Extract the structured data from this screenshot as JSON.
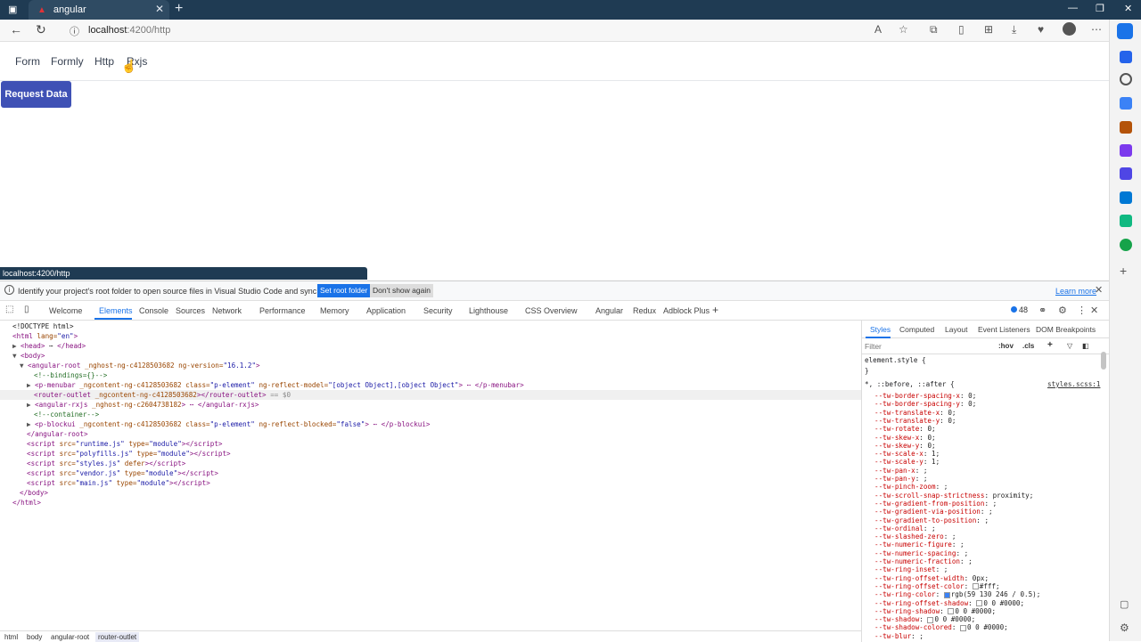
{
  "browser": {
    "tab_title": "angular",
    "url_host": "localhost",
    "url_path": ":4200/http"
  },
  "page": {
    "menu": [
      "Form",
      "Formly",
      "Http",
      "Rxjs"
    ],
    "request_button": "Request Data",
    "status_url": "localhost:4200/http"
  },
  "devtools": {
    "infobar": {
      "message": "Identify your project's root folder to open source files in Visual Studio Code and sync changes.",
      "set_root": "Set root folder",
      "dont_show": "Don't show again",
      "learn_more": "Learn more"
    },
    "tabs": [
      "Welcome",
      "Elements",
      "Console",
      "Sources",
      "Network",
      "Performance",
      "Memory",
      "Application",
      "Security",
      "Lighthouse",
      "CSS Overview",
      "Angular",
      "Redux",
      "Adblock Plus"
    ],
    "active_tab": "Elements",
    "issues_count": "48",
    "breadcrumbs": [
      "html",
      "body",
      "angular-root",
      "router-outlet"
    ],
    "styles": {
      "tabs": [
        "Styles",
        "Computed",
        "Layout",
        "Event Listeners",
        "DOM Breakpoints"
      ],
      "filter_placeholder": "Filter",
      "hov": ":hov",
      "cls": ".cls",
      "element_style": "element.style {",
      "element_close": "}",
      "selector": "*, ::before, ::after {",
      "source": "styles.scss:1",
      "props": [
        {
          "name": "--tw-border-spacing-x",
          "value": "0;"
        },
        {
          "name": "--tw-border-spacing-y",
          "value": "0;"
        },
        {
          "name": "--tw-translate-x",
          "value": "0;"
        },
        {
          "name": "--tw-translate-y",
          "value": "0;"
        },
        {
          "name": "--tw-rotate",
          "value": "0;"
        },
        {
          "name": "--tw-skew-x",
          "value": "0;"
        },
        {
          "name": "--tw-skew-y",
          "value": "0;"
        },
        {
          "name": "--tw-scale-x",
          "value": "1;"
        },
        {
          "name": "--tw-scale-y",
          "value": "1;"
        },
        {
          "name": "--tw-pan-x",
          "value": ";"
        },
        {
          "name": "--tw-pan-y",
          "value": ";"
        },
        {
          "name": "--tw-pinch-zoom",
          "value": ";"
        },
        {
          "name": "--tw-scroll-snap-strictness",
          "value": "proximity;"
        },
        {
          "name": "--tw-gradient-from-position",
          "value": ";"
        },
        {
          "name": "--tw-gradient-via-position",
          "value": ";"
        },
        {
          "name": "--tw-gradient-to-position",
          "value": ";"
        },
        {
          "name": "--tw-ordinal",
          "value": ";"
        },
        {
          "name": "--tw-slashed-zero",
          "value": ";"
        },
        {
          "name": "--tw-numeric-figure",
          "value": ";"
        },
        {
          "name": "--tw-numeric-spacing",
          "value": ";"
        },
        {
          "name": "--tw-numeric-fraction",
          "value": ";"
        },
        {
          "name": "--tw-ring-inset",
          "value": ";"
        },
        {
          "name": "--tw-ring-offset-width",
          "value": "0px;"
        },
        {
          "name": "--tw-ring-offset-color",
          "value": "#fff;",
          "swatch": "#ffffff"
        },
        {
          "name": "--tw-ring-color",
          "value": "rgb(59 130 246 / 0.5);",
          "swatch": "#3b82f6"
        },
        {
          "name": "--tw-ring-offset-shadow",
          "value": "0 0 #0000;",
          "swatch": "#ffffff"
        },
        {
          "name": "--tw-ring-shadow",
          "value": "0 0 #0000;",
          "swatch": "#ffffff"
        },
        {
          "name": "--tw-shadow",
          "value": "0 0 #0000;",
          "swatch": "#ffffff"
        },
        {
          "name": "--tw-shadow-colored",
          "value": "0 0 #0000;",
          "swatch": "#ffffff"
        },
        {
          "name": "--tw-blur",
          "value": ";"
        }
      ]
    },
    "dom": {
      "l1": "<!DOCTYPE html>",
      "l2_tag": "<html",
      "l2_attr": " lang=",
      "l2_val": "\"en\"",
      "l2_end": ">",
      "l3": "<head>",
      "l3_end": "</head>",
      "l4": "<body>",
      "l5_tag": "<angular-root",
      "l5_attr": " _nghost-ng-c4128503682 ng-version=",
      "l5_val": "\"16.1.2\"",
      "l5_end": ">",
      "l6": "<!--bindings={}-->",
      "l7_tag": "<p-menubar",
      "l7_attr1": " _ngcontent-ng-c4128503682 class=",
      "l7_val1": "\"p-element\"",
      "l7_attr2": " ng-reflect-model=",
      "l7_val2": "\"[object Object],[object Object\"",
      "l7_end": "> ⋯ </p-menubar>",
      "l8_tag": "<router-outlet",
      "l8_attr": " _ngcontent-ng-c4128503682",
      "l8_end": "></router-outlet>",
      "l8_eq": "== $0",
      "l9_tag": "<angular-rxjs",
      "l9_attr": " _nghost-ng-c2604738182",
      "l9_end": "> ⋯ </angular-rxjs>",
      "l10": "<!--container-->",
      "l11_tag": "<p-blockui",
      "l11_attr1": " _ngcontent-ng-c4128503682 class=",
      "l11_val1": "\"p-element\"",
      "l11_attr2": " ng-reflect-blocked=",
      "l11_val2": "\"false\"",
      "l11_end": "> ⋯ </p-blockui>",
      "l12": "</angular-root>",
      "scripts": [
        {
          "src": "\"runtime.js\"",
          "type": "\"module\""
        },
        {
          "src": "\"polyfills.js\"",
          "type": "\"module\""
        },
        {
          "src": "\"styles.js\"",
          "type": "defer"
        },
        {
          "src": "\"vendor.js\"",
          "type": "\"module\""
        },
        {
          "src": "\"main.js\"",
          "type": "\"module\""
        }
      ],
      "l18": "</body>",
      "l19": "</html>"
    }
  }
}
